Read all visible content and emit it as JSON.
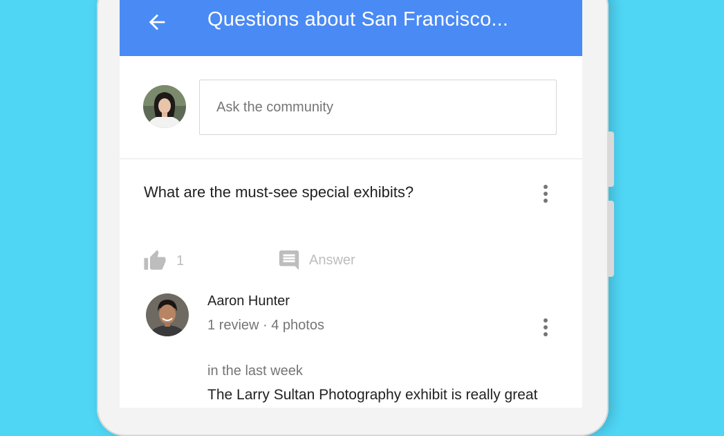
{
  "header": {
    "title": "Questions about San Francisco..."
  },
  "ask": {
    "placeholder": "Ask the community"
  },
  "question": {
    "text": "What are the must-see special exhibits?",
    "like_count": "1",
    "answer_label": "Answer"
  },
  "answer": {
    "author_name": "Aaron Hunter",
    "author_meta": "1 review · 4 photos",
    "time": "in the last week",
    "text": "The Larry Sultan Photography exhibit is really great"
  },
  "colors": {
    "background": "#4fd6f5",
    "app_bar": "#4a8af4",
    "primary_text": "#212121",
    "secondary_text": "#757575",
    "disabled_text": "#bdbdbd"
  },
  "icons": [
    "back-arrow-icon",
    "overflow-menu-icon",
    "thumb-up-icon",
    "comment-icon"
  ]
}
